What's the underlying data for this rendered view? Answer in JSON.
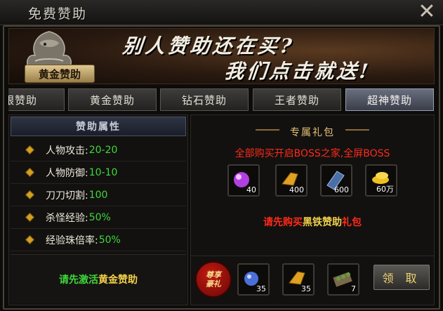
{
  "window": {
    "title": "免费赞助",
    "close_label": "✕"
  },
  "banner": {
    "slogan_line1": "别人赞助还在买?",
    "slogan_line2": "我们点击就送!",
    "emblem_label": "黄金赞助"
  },
  "tabs": [
    {
      "label": "银赞助",
      "active": false
    },
    {
      "label": "黄金赞助",
      "active": false
    },
    {
      "label": "钻石赞助",
      "active": false
    },
    {
      "label": "王者赞助",
      "active": false
    },
    {
      "label": "超神赞助",
      "active": true
    }
  ],
  "attributes": {
    "header": "赞助属性",
    "rows": [
      {
        "label": "人物攻击:",
        "value": "20-20"
      },
      {
        "label": "人物防御:",
        "value": "10-10"
      },
      {
        "label": "刀刀切割:",
        "value": "100"
      },
      {
        "label": "杀怪经验:",
        "value": "50%"
      },
      {
        "label": "经验珠倍率:",
        "value": "50%"
      }
    ],
    "activate_prefix": "请先激活",
    "activate_target": "黄金赞助"
  },
  "gift": {
    "title": "专属礼包",
    "description": "全部购买开启BOSS之家,全屏BOSS",
    "items": [
      {
        "icon": "purple-orb-icon",
        "count": "40",
        "color": "#b040e0"
      },
      {
        "icon": "gold-ingot-icon",
        "count": "400",
        "color": "#e0a020"
      },
      {
        "icon": "blue-scroll-icon",
        "count": "600",
        "color": "#4a6ea8"
      },
      {
        "icon": "gold-coins-icon",
        "count": "60万",
        "color": "#f0c020"
      }
    ],
    "buy_prefix": "请先购买",
    "buy_target": "黑铁赞助",
    "buy_suffix": "礼包"
  },
  "honor": {
    "badge_line1": "尊享",
    "badge_line2": "豪礼",
    "items": [
      {
        "icon": "blue-orb-icon",
        "count": "35",
        "color": "#4a70d8"
      },
      {
        "icon": "gold-ingot-icon",
        "count": "35",
        "color": "#e0a020"
      },
      {
        "icon": "green-seed-bundle-icon",
        "count": "7",
        "color": "#6a9a40"
      }
    ],
    "claim_label": "领 取"
  }
}
